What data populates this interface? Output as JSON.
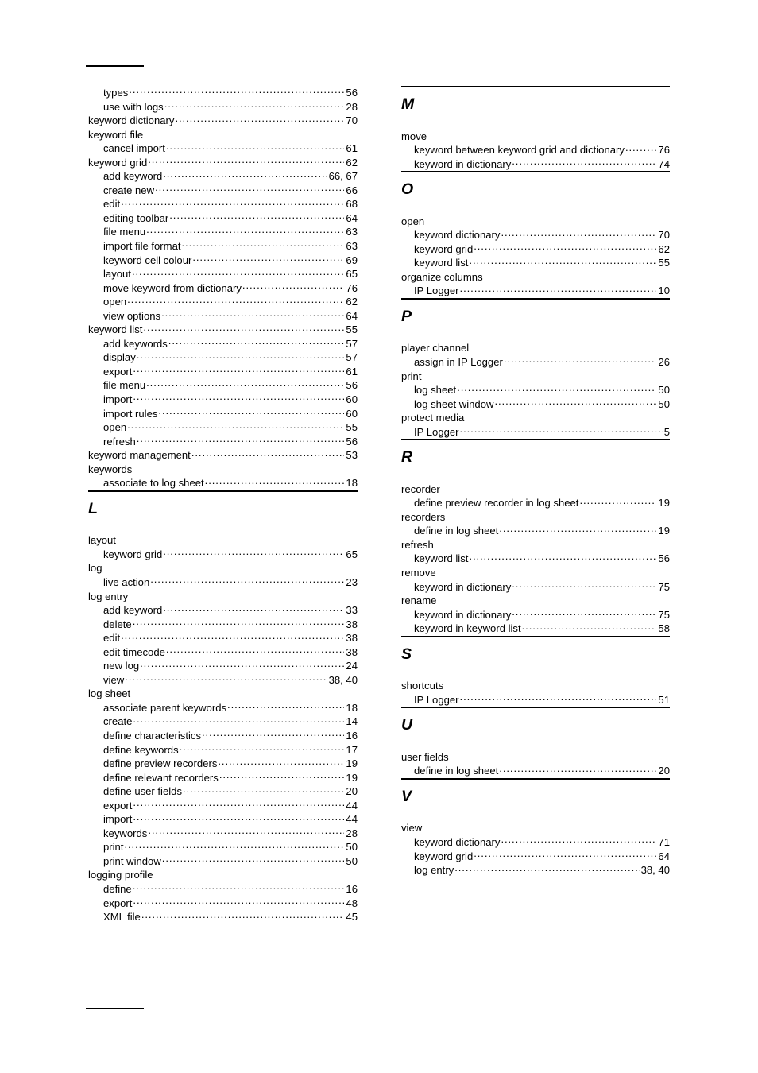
{
  "document": {
    "type": "index",
    "header_rule": true,
    "footer_rule": true
  },
  "columns": {
    "left": {
      "sections": [
        {
          "letter": "",
          "continued": true,
          "entries": [
            {
              "text": "types",
              "page": "56",
              "level": "sub"
            },
            {
              "text": "use with logs",
              "page": "28",
              "level": "sub"
            },
            {
              "text": "keyword dictionary",
              "page": "70",
              "level": "main"
            },
            {
              "text": "keyword file",
              "page": "",
              "level": "main"
            },
            {
              "text": "cancel import",
              "page": "61",
              "level": "sub"
            },
            {
              "text": "keyword grid",
              "page": "62",
              "level": "main"
            },
            {
              "text": "add keyword",
              "page": "66, 67",
              "level": "sub"
            },
            {
              "text": "create new",
              "page": "66",
              "level": "sub"
            },
            {
              "text": "edit",
              "page": "68",
              "level": "sub"
            },
            {
              "text": "editing toolbar",
              "page": "64",
              "level": "sub"
            },
            {
              "text": "file menu",
              "page": "63",
              "level": "sub"
            },
            {
              "text": "import file format",
              "page": "63",
              "level": "sub"
            },
            {
              "text": "keyword cell colour",
              "page": "69",
              "level": "sub"
            },
            {
              "text": "layout",
              "page": "65",
              "level": "sub"
            },
            {
              "text": "move keyword from dictionary",
              "page": "76",
              "level": "sub"
            },
            {
              "text": "open",
              "page": "62",
              "level": "sub"
            },
            {
              "text": "view options",
              "page": "64",
              "level": "sub"
            },
            {
              "text": "keyword list",
              "page": "55",
              "level": "main"
            },
            {
              "text": "add keywords",
              "page": "57",
              "level": "sub"
            },
            {
              "text": "display",
              "page": "57",
              "level": "sub"
            },
            {
              "text": "export",
              "page": "61",
              "level": "sub"
            },
            {
              "text": "file menu",
              "page": "56",
              "level": "sub"
            },
            {
              "text": "import",
              "page": "60",
              "level": "sub"
            },
            {
              "text": "import rules",
              "page": "60",
              "level": "sub"
            },
            {
              "text": "open",
              "page": "55",
              "level": "sub"
            },
            {
              "text": "refresh",
              "page": "56",
              "level": "sub"
            },
            {
              "text": "keyword management",
              "page": "53",
              "level": "main"
            },
            {
              "text": "keywords",
              "page": "",
              "level": "main"
            },
            {
              "text": "associate to log sheet",
              "page": "18",
              "level": "sub"
            }
          ]
        },
        {
          "letter": "L",
          "continued": false,
          "entries": [
            {
              "text": "layout",
              "page": "",
              "level": "main"
            },
            {
              "text": "keyword grid",
              "page": "65",
              "level": "sub"
            },
            {
              "text": "log",
              "page": "",
              "level": "main"
            },
            {
              "text": "live action",
              "page": "23",
              "level": "sub"
            },
            {
              "text": "log entry",
              "page": "",
              "level": "main"
            },
            {
              "text": "add keyword",
              "page": "33",
              "level": "sub"
            },
            {
              "text": "delete",
              "page": "38",
              "level": "sub"
            },
            {
              "text": "edit",
              "page": "38",
              "level": "sub"
            },
            {
              "text": "edit timecode",
              "page": "38",
              "level": "sub"
            },
            {
              "text": "new log",
              "page": "24",
              "level": "sub"
            },
            {
              "text": "view",
              "page": "38, 40",
              "level": "sub"
            },
            {
              "text": "log sheet",
              "page": "",
              "level": "main"
            },
            {
              "text": "associate parent keywords",
              "page": "18",
              "level": "sub"
            },
            {
              "text": "create",
              "page": "14",
              "level": "sub"
            },
            {
              "text": "define characteristics",
              "page": "16",
              "level": "sub"
            },
            {
              "text": "define keywords",
              "page": "17",
              "level": "sub"
            },
            {
              "text": "define preview recorders",
              "page": "19",
              "level": "sub"
            },
            {
              "text": "define relevant recorders",
              "page": "19",
              "level": "sub"
            },
            {
              "text": "define user fields",
              "page": "20",
              "level": "sub"
            },
            {
              "text": "export",
              "page": "44",
              "level": "sub"
            },
            {
              "text": "import",
              "page": "44",
              "level": "sub"
            },
            {
              "text": "keywords",
              "page": "28",
              "level": "sub"
            },
            {
              "text": "print",
              "page": "50",
              "level": "sub"
            },
            {
              "text": "print window",
              "page": "50",
              "level": "sub"
            },
            {
              "text": "logging profile",
              "page": "",
              "level": "main"
            },
            {
              "text": "define",
              "page": "16",
              "level": "sub"
            },
            {
              "text": "export",
              "page": "48",
              "level": "sub"
            },
            {
              "text": "XML file",
              "page": "45",
              "level": "sub"
            }
          ]
        }
      ]
    },
    "right": {
      "sections": [
        {
          "letter": "M",
          "continued": false,
          "entries": [
            {
              "text": "move",
              "page": "",
              "level": "main"
            },
            {
              "text": "keyword between keyword grid and dictionary",
              "page": "76",
              "level": "sub"
            },
            {
              "text": "keyword in dictionary",
              "page": "74",
              "level": "sub"
            }
          ]
        },
        {
          "letter": "O",
          "continued": false,
          "entries": [
            {
              "text": "open",
              "page": "",
              "level": "main"
            },
            {
              "text": "keyword dictionary",
              "page": "70",
              "level": "sub"
            },
            {
              "text": "keyword grid",
              "page": "62",
              "level": "sub"
            },
            {
              "text": "keyword list",
              "page": "55",
              "level": "sub"
            },
            {
              "text": "organize columns",
              "page": "",
              "level": "main"
            },
            {
              "text": "IP Logger",
              "page": "10",
              "level": "sub"
            }
          ]
        },
        {
          "letter": "P",
          "continued": false,
          "entries": [
            {
              "text": "player channel",
              "page": "",
              "level": "main"
            },
            {
              "text": "assign in IP Logger",
              "page": "26",
              "level": "sub"
            },
            {
              "text": "print",
              "page": "",
              "level": "main"
            },
            {
              "text": "log sheet",
              "page": "50",
              "level": "sub"
            },
            {
              "text": "log sheet window",
              "page": "50",
              "level": "sub"
            },
            {
              "text": "protect media",
              "page": "",
              "level": "main"
            },
            {
              "text": "IP Logger",
              "page": "5",
              "level": "sub"
            }
          ]
        },
        {
          "letter": "R",
          "continued": false,
          "entries": [
            {
              "text": "recorder",
              "page": "",
              "level": "main"
            },
            {
              "text": "define preview recorder in log sheet",
              "page": "19",
              "level": "sub"
            },
            {
              "text": "recorders",
              "page": "",
              "level": "main"
            },
            {
              "text": "define in log sheet",
              "page": "19",
              "level": "sub"
            },
            {
              "text": "refresh",
              "page": "",
              "level": "main"
            },
            {
              "text": "keyword list",
              "page": "56",
              "level": "sub"
            },
            {
              "text": "remove",
              "page": "",
              "level": "main"
            },
            {
              "text": "keyword in dictionary",
              "page": "75",
              "level": "sub"
            },
            {
              "text": "rename",
              "page": "",
              "level": "main"
            },
            {
              "text": "keyword in dictionary",
              "page": "75",
              "level": "sub"
            },
            {
              "text": "keyword in keyword list",
              "page": "58",
              "level": "sub"
            }
          ]
        },
        {
          "letter": "S",
          "continued": false,
          "entries": [
            {
              "text": "shortcuts",
              "page": "",
              "level": "main"
            },
            {
              "text": "IP Logger",
              "page": "51",
              "level": "sub"
            }
          ]
        },
        {
          "letter": "U",
          "continued": false,
          "entries": [
            {
              "text": "user fields",
              "page": "",
              "level": "main"
            },
            {
              "text": "define in log sheet",
              "page": "20",
              "level": "sub"
            }
          ]
        },
        {
          "letter": "V",
          "continued": false,
          "entries": [
            {
              "text": "view",
              "page": "",
              "level": "main"
            },
            {
              "text": "keyword dictionary",
              "page": "71",
              "level": "sub"
            },
            {
              "text": "keyword grid",
              "page": "64",
              "level": "sub"
            },
            {
              "text": "log entry",
              "page": "38, 40",
              "level": "sub"
            }
          ]
        }
      ]
    }
  }
}
